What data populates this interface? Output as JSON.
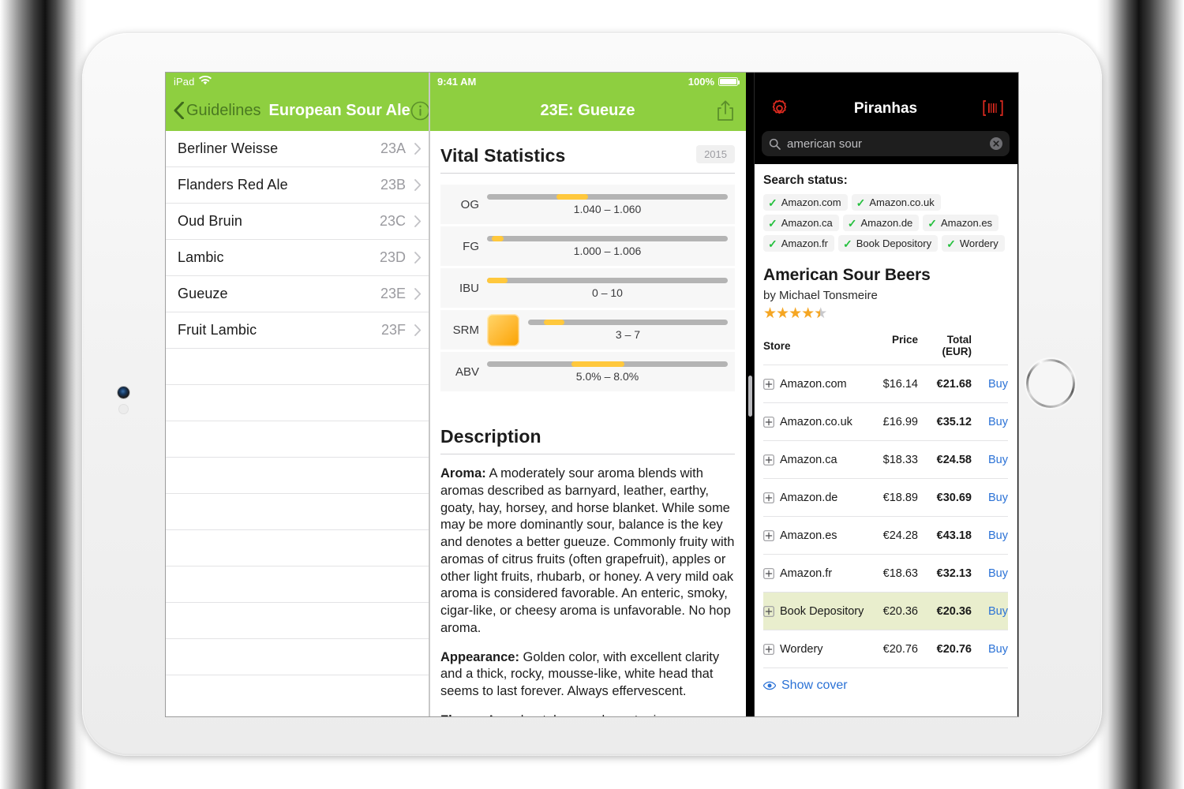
{
  "colors": {
    "brand_green": "#8ecf40",
    "accent_orange": "#ffc83d",
    "link_blue": "#2b72d6",
    "tick_green": "#25c03e",
    "star_gold": "#f5a623",
    "highlight_row": "#e9eecd"
  },
  "left_pane": {
    "status": {
      "device": "iPad",
      "wifi_icon": "wifi-icon"
    },
    "nav": {
      "back_icon": "chevron-left-icon",
      "back_label": "Guidelines",
      "title": "European Sour Ale",
      "info_icon": "info-circle-icon"
    },
    "items": [
      {
        "name": "Berliner Weisse",
        "code": "23A"
      },
      {
        "name": "Flanders Red Ale",
        "code": "23B"
      },
      {
        "name": "Oud Bruin",
        "code": "23C"
      },
      {
        "name": "Lambic",
        "code": "23D"
      },
      {
        "name": "Gueuze",
        "code": "23E"
      },
      {
        "name": "Fruit Lambic",
        "code": "23F"
      }
    ],
    "blank_row_count": 9,
    "disclosure_icon": "chevron-right-icon"
  },
  "middle_pane": {
    "status": {
      "time": "9:41 AM",
      "battery_percent": "100%",
      "battery_icon": "battery-full-icon"
    },
    "nav": {
      "title": "23E: Gueuze",
      "share_icon": "share-icon"
    },
    "vital": {
      "heading": "Vital Statistics",
      "year_badge": "2015",
      "rows": [
        {
          "label": "OG",
          "range_text": "1.040 – 1.060",
          "fill_start_pct": 29,
          "fill_width_pct": 13,
          "swatch": false
        },
        {
          "label": "FG",
          "range_text": "1.000 – 1.006",
          "fill_start_pct": 2,
          "fill_width_pct": 5,
          "swatch": false
        },
        {
          "label": "IBU",
          "range_text": "0 – 10",
          "fill_start_pct": 0,
          "fill_width_pct": 8.5,
          "swatch": false
        },
        {
          "label": "SRM",
          "range_text": "3 – 7",
          "fill_start_pct": 8,
          "fill_width_pct": 10,
          "swatch": true
        },
        {
          "label": "ABV",
          "range_text": "5.0% – 8.0%",
          "fill_start_pct": 35,
          "fill_width_pct": 22,
          "swatch": false
        }
      ]
    },
    "description": {
      "heading": "Description",
      "paragraphs": [
        {
          "lead": "Aroma:",
          "text": " A moderately sour aroma blends with aromas described as barnyard, leather, earthy, goaty, hay, horsey, and horse blanket. While some may be more dominantly sour, balance is the key and denotes a better gueuze. Commonly fruity with aromas of citrus fruits (often grapefruit), apples or other light fruits, rhubarb, or honey. A very mild oak aroma is considered favorable. An enteric, smoky, cigar-like, or cheesy aroma is unfavorable. No hop aroma."
        },
        {
          "lead": "Appearance:",
          "text": " Golden color, with excellent clarity and a thick, rocky, mousse-like, white head that seems to last forever. Always effervescent."
        },
        {
          "lead": "Flavor:",
          "text": " A moderately sour character is"
        }
      ]
    }
  },
  "right_pane": {
    "nav": {
      "title": "Piranhas",
      "gear_icon": "gear-icon",
      "barcode_icon": "barcode-scan-icon"
    },
    "search": {
      "value": "american sour",
      "placeholder": "Search",
      "search_icon": "search-icon",
      "clear_icon": "clear-circle-icon"
    },
    "search_status": {
      "label": "Search status:",
      "stores": [
        "Amazon.com",
        "Amazon.co.uk",
        "Amazon.ca",
        "Amazon.de",
        "Amazon.es",
        "Amazon.fr",
        "Book Depository",
        "Wordery"
      ],
      "check_icon": "check-icon"
    },
    "product": {
      "title": "American Sour Beers",
      "author": "by Michael Tonsmeire",
      "rating": 4.5,
      "rating_max": 5
    },
    "table": {
      "headers": {
        "store": "Store",
        "price": "Price",
        "total": "Total (EUR)",
        "action": ""
      },
      "expand_icon": "expand-plus-icon",
      "buy_label": "Buy",
      "rows": [
        {
          "store": "Amazon.com",
          "price": "$16.14",
          "total": "€21.68",
          "buy": "Buy",
          "highlight": false
        },
        {
          "store": "Amazon.co.uk",
          "price": "£16.99",
          "total": "€35.12",
          "buy": "Buy",
          "highlight": false
        },
        {
          "store": "Amazon.ca",
          "price": "$18.33",
          "total": "€24.58",
          "buy": "Buy",
          "highlight": false
        },
        {
          "store": "Amazon.de",
          "price": "€18.89",
          "total": "€30.69",
          "buy": "Buy",
          "highlight": false
        },
        {
          "store": "Amazon.es",
          "price": "€24.28",
          "total": "€43.18",
          "buy": "Buy",
          "highlight": false
        },
        {
          "store": "Amazon.fr",
          "price": "€18.63",
          "total": "€32.13",
          "buy": "Buy",
          "highlight": false
        },
        {
          "store": "Book Depository",
          "price": "€20.36",
          "total": "€20.36",
          "buy": "Buy",
          "highlight": true
        },
        {
          "store": "Wordery",
          "price": "€20.76",
          "total": "€20.76",
          "buy": "Buy",
          "highlight": false
        }
      ]
    },
    "show_cover": {
      "label": "Show cover",
      "icon": "eye-icon"
    }
  }
}
